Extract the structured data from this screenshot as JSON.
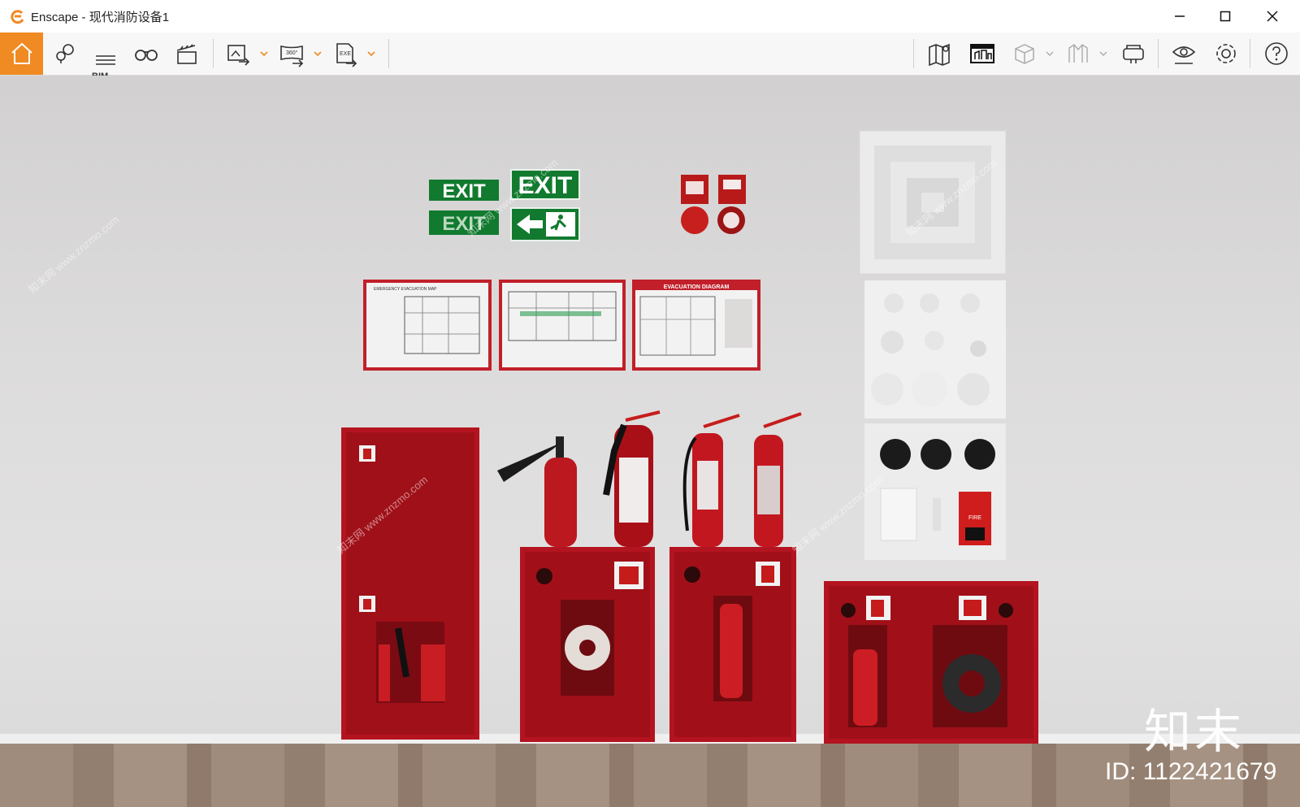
{
  "window": {
    "app_name": "Enscape",
    "title": "Enscape - 现代消防设备1"
  },
  "toolbar": {
    "bim_label": "BIM",
    "left_tools": [
      "home-icon",
      "location-pin-icon",
      "bim-icon",
      "binoculars-icon",
      "clapper-icon",
      "export-image-icon",
      "export-360-icon",
      "export-exe-icon"
    ],
    "right_tools": [
      "map-icon",
      "asset-library-icon",
      "cube-icon",
      "sketch-icon",
      "vr-headset-icon",
      "eye-icon",
      "gear-icon",
      "help-icon"
    ],
    "accent_color": "#f08a22"
  },
  "scene": {
    "exit_signs": [
      "EXIT",
      "EXIT",
      "EXIT"
    ],
    "evacuation_title": "EVACUATION DIAGRAM",
    "emergency_map_title": "EMERGENCY EVACUATION MAP",
    "fire_alarm_label": "FIRE",
    "watermark_text": "知末网 www.znzmo.com",
    "brand_watermark": "知末",
    "id_text": "ID: 1122421679"
  }
}
